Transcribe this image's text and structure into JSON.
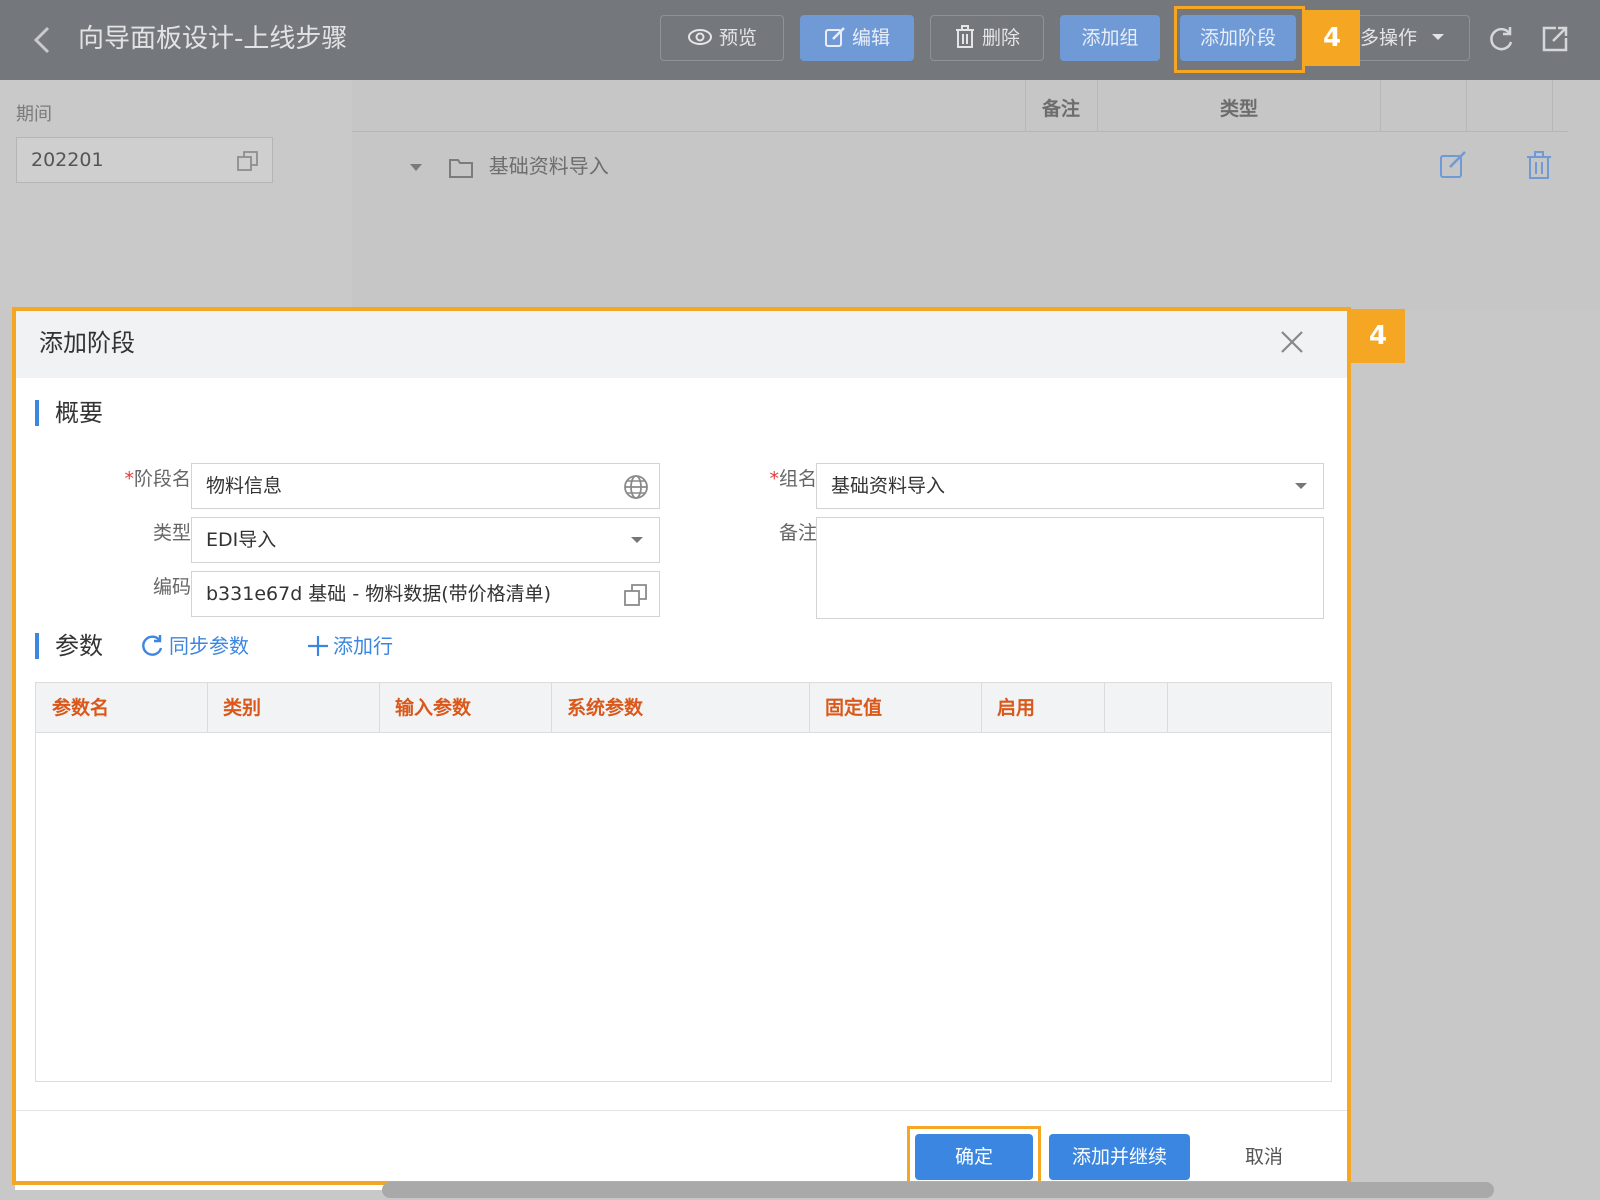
{
  "header": {
    "title": "向导面板设计-上线步骤",
    "buttons": {
      "preview": "预览",
      "edit": "编辑",
      "delete": "删除",
      "add_group": "添加组",
      "add_stage": "添加阶段",
      "more": "多操作"
    },
    "callout_number": "4"
  },
  "left_panel": {
    "period_label": "期间",
    "period_value": "202201"
  },
  "grid": {
    "columns": [
      "备注",
      "类型"
    ],
    "tree_row_label": "基础资料导入"
  },
  "modal": {
    "title": "添加阶段",
    "callout_number": "4",
    "overview_section": "概要",
    "fields": {
      "stage_name_label": "阶段名",
      "stage_name_value": "物料信息",
      "group_name_label": "组名",
      "group_name_value": "基础资料导入",
      "type_label": "类型",
      "type_value": "EDI导入",
      "remark_label": "备注",
      "code_label": "编码",
      "code_value": "b331e67d 基础 - 物料数据(带价格清单)"
    },
    "params_section": "参数",
    "sync_params": "同步参数",
    "add_row": "添加行",
    "param_columns": [
      "参数名",
      "类别",
      "输入参数",
      "系统参数",
      "固定值",
      "启用"
    ],
    "footer": {
      "confirm": "确定",
      "add_continue": "添加并继续",
      "cancel": "取消"
    }
  },
  "colors": {
    "accent": "#3b86e0",
    "callout": "#f5a623",
    "column_header_text": "#d9581a",
    "required": "#e4393c"
  }
}
